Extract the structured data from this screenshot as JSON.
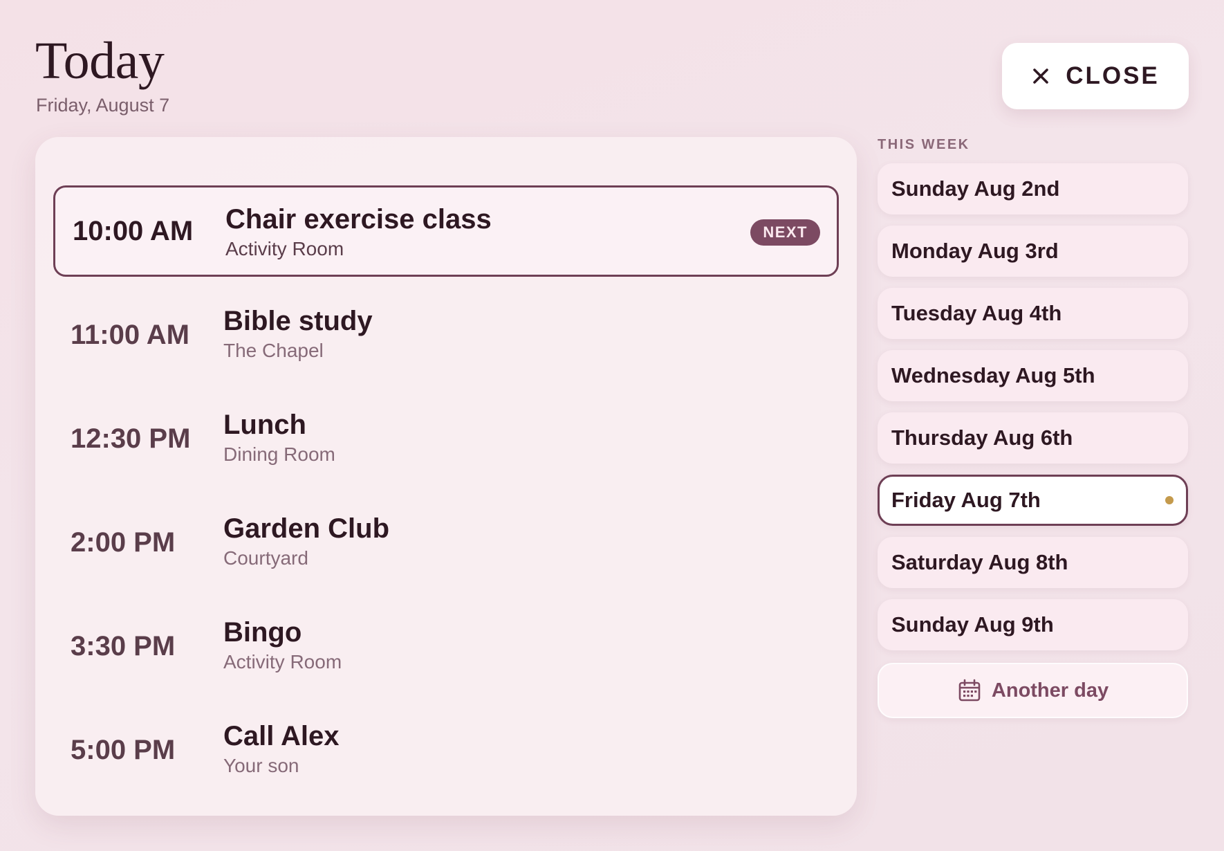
{
  "header": {
    "title": "Today",
    "date": "Friday, August 7",
    "close_label": "CLOSE"
  },
  "schedule": {
    "next_badge": "NEXT",
    "events": [
      {
        "time": "10:00 AM",
        "title": "Chair exercise class",
        "location": "Activity Room",
        "is_next": true
      },
      {
        "time": "11:00 AM",
        "title": "Bible study",
        "location": "The Chapel",
        "is_next": false
      },
      {
        "time": "12:30 PM",
        "title": "Lunch",
        "location": "Dining Room",
        "is_next": false
      },
      {
        "time": "2:00 PM",
        "title": "Garden Club",
        "location": "Courtyard",
        "is_next": false
      },
      {
        "time": "3:30 PM",
        "title": "Bingo",
        "location": "Activity Room",
        "is_next": false
      },
      {
        "time": "5:00 PM",
        "title": "Call Alex",
        "location": "Your son",
        "is_next": false
      }
    ]
  },
  "week": {
    "heading": "THIS WEEK",
    "days": [
      {
        "label": "Sunday Aug 2nd",
        "selected": false
      },
      {
        "label": "Monday Aug 3rd",
        "selected": false
      },
      {
        "label": "Tuesday Aug 4th",
        "selected": false
      },
      {
        "label": "Wednesday Aug 5th",
        "selected": false
      },
      {
        "label": "Thursday Aug 6th",
        "selected": false
      },
      {
        "label": "Friday Aug 7th",
        "selected": true
      },
      {
        "label": "Saturday Aug 8th",
        "selected": false
      },
      {
        "label": "Sunday Aug 9th",
        "selected": false
      }
    ],
    "another_day_label": "Another day"
  },
  "icons": {
    "close": "close-icon",
    "calendar": "calendar-icon",
    "today_indicator": "today-dot"
  },
  "colors": {
    "accent": "#7c4a62",
    "border": "#6e3f55",
    "today_dot": "#c49a4c",
    "text_primary": "#2e1822",
    "text_muted": "#866a78"
  }
}
